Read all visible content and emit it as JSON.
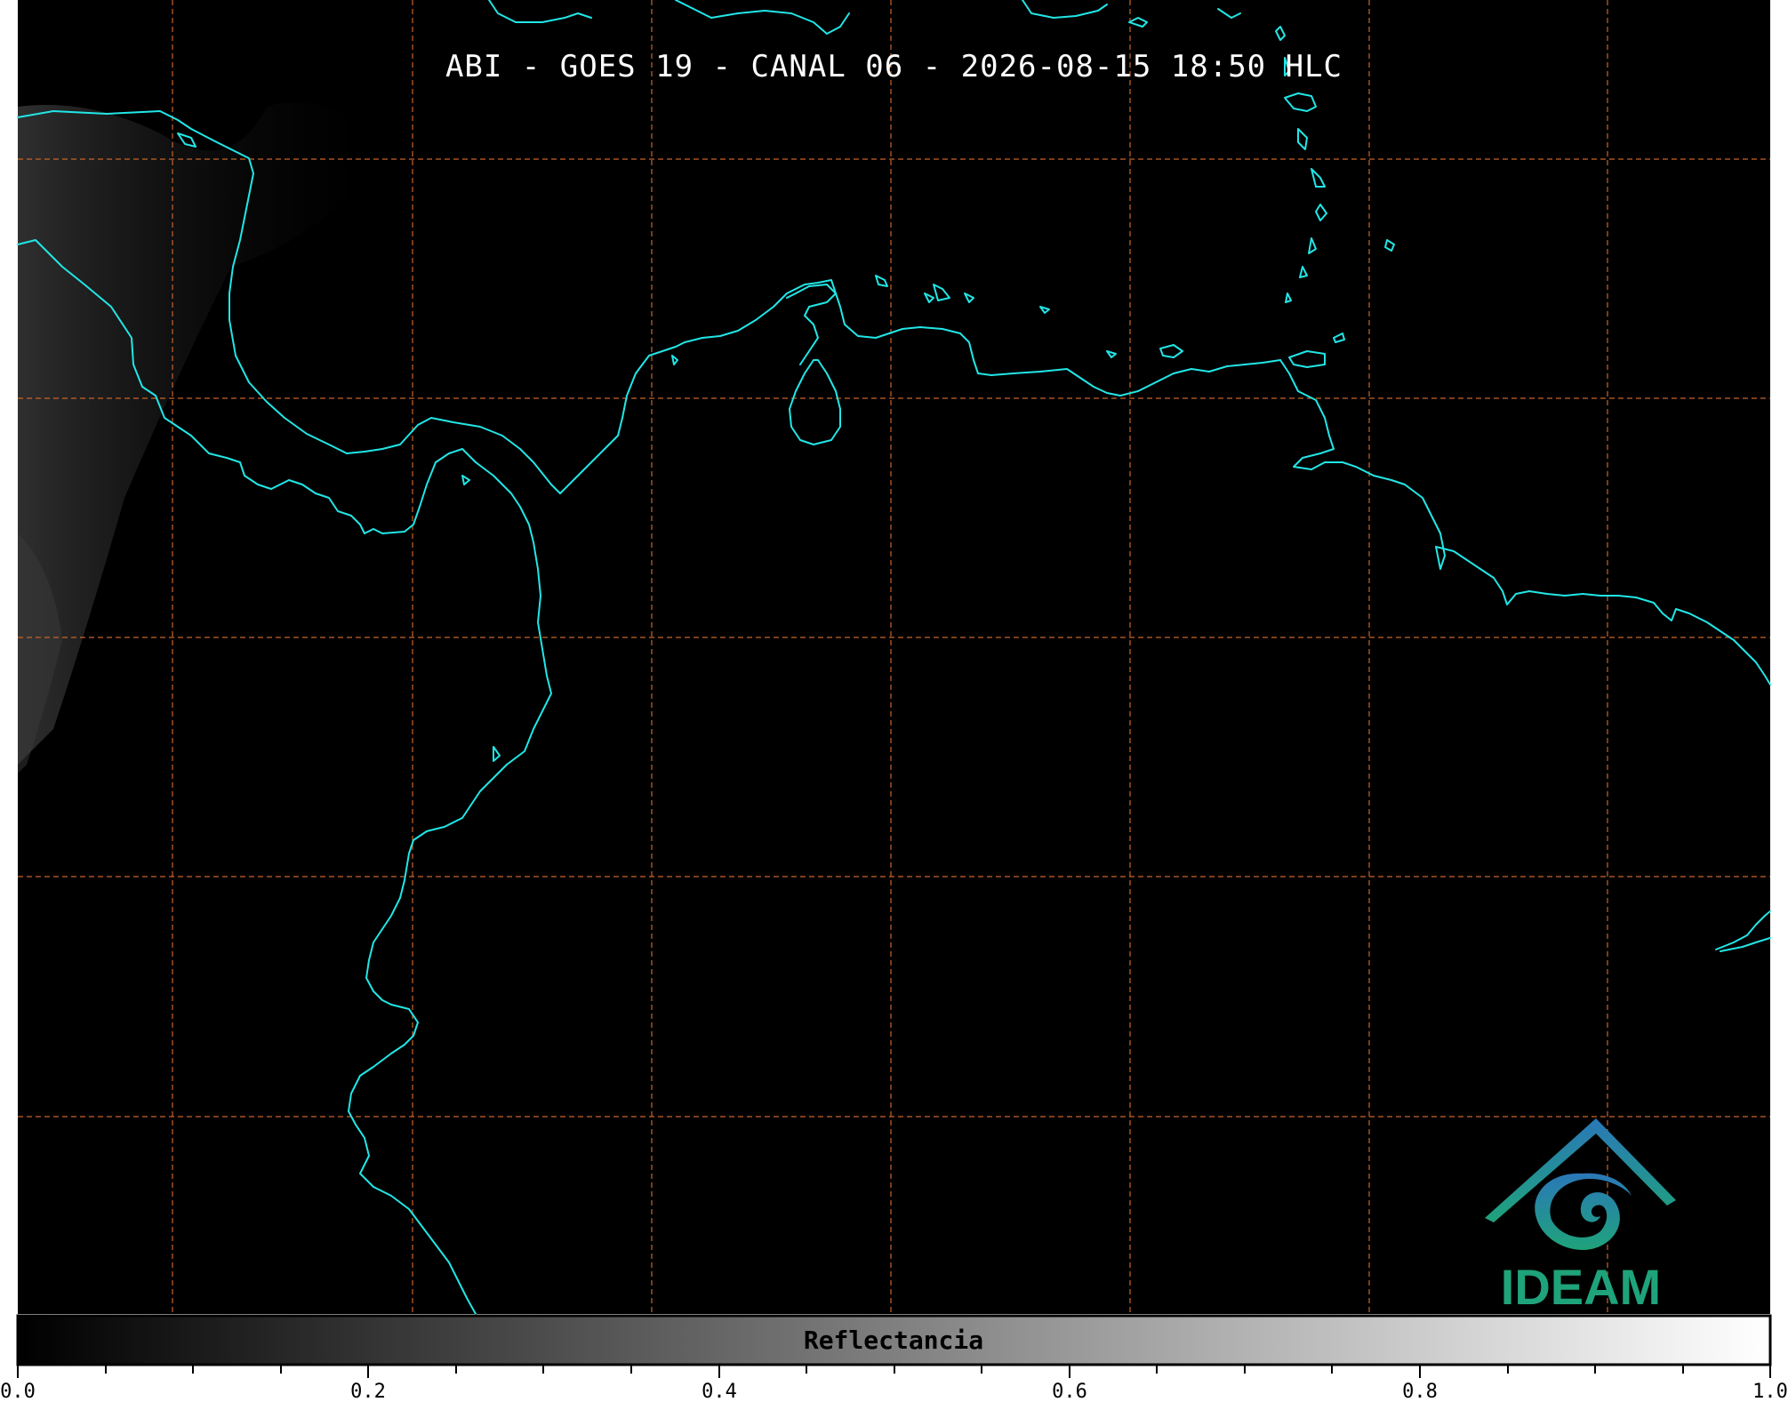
{
  "title": "ABI - GOES 19 - CANAL 06 - 2026-08-15 18:50 HLC",
  "colorbar": {
    "label": "Reflectancia",
    "ticks": [
      "0.0",
      "0.2",
      "0.4",
      "0.6",
      "0.8",
      "1.0"
    ],
    "min": 0.0,
    "max": 1.0,
    "colormap": [
      "#000000",
      "#ffffff"
    ]
  },
  "logo": {
    "text": "IDEAM"
  },
  "colors": {
    "coastline": "#22e6e6",
    "gridlines": "#c8642a",
    "background": "#000000",
    "logo_blue": "#2a78b8",
    "logo_green": "#1fa37a"
  }
}
